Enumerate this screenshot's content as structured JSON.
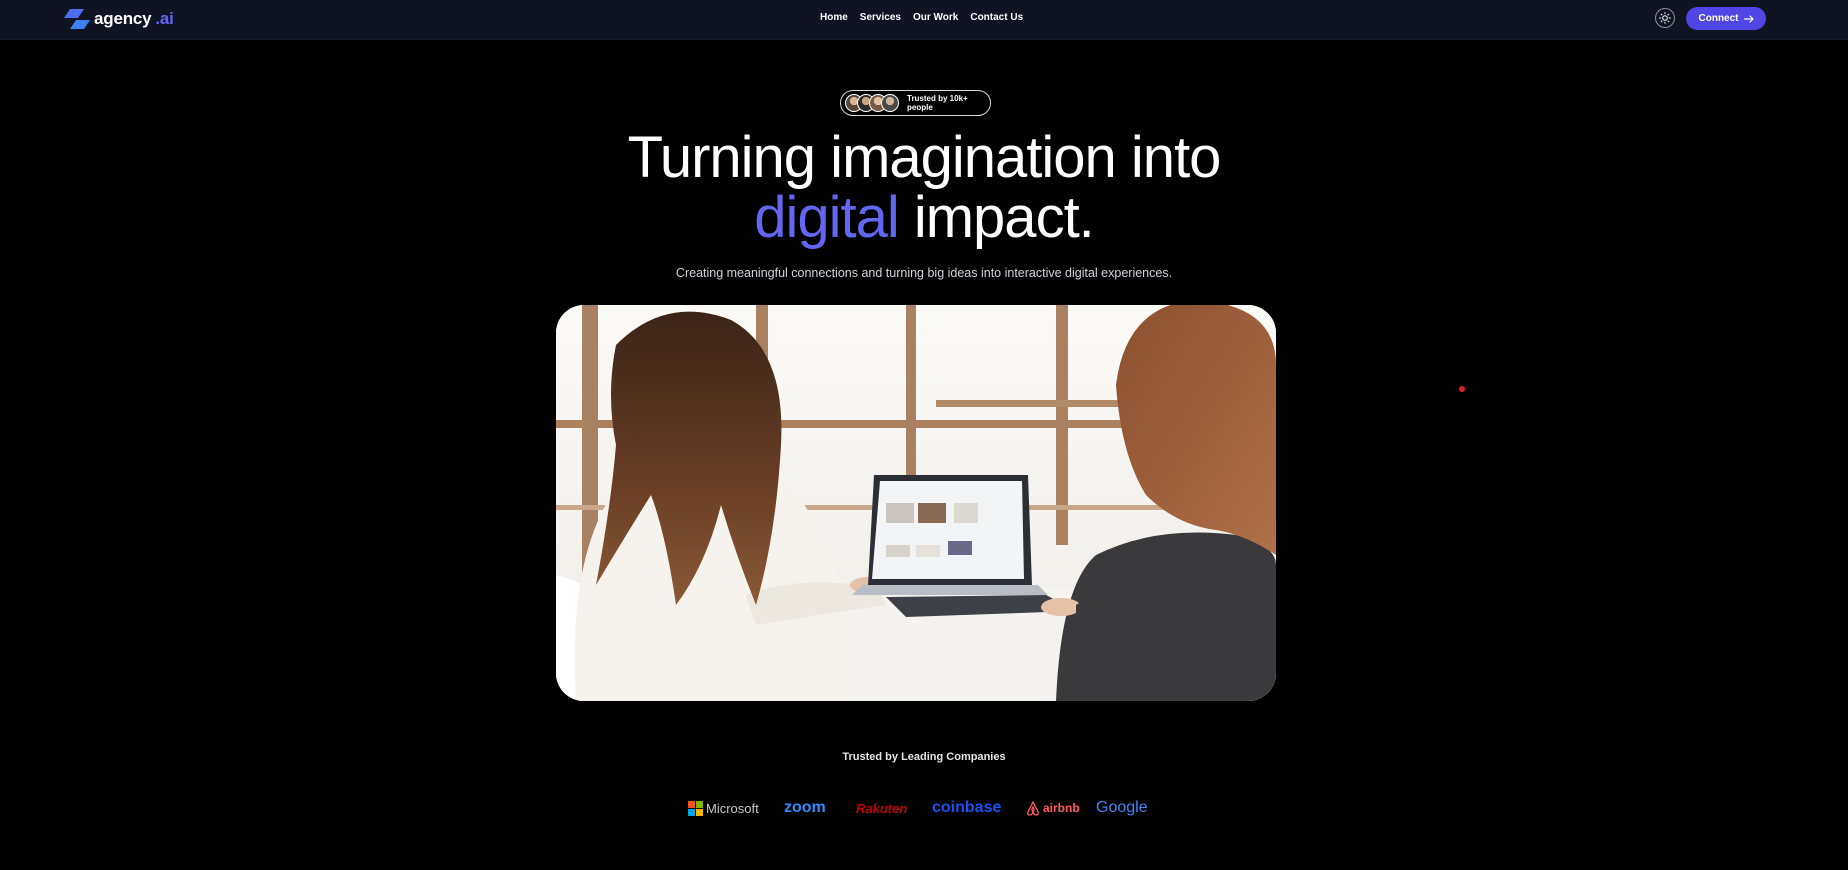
{
  "brand": {
    "name": "agency",
    "accent": ".ai"
  },
  "nav": {
    "links": [
      "Home",
      "Services",
      "Our Work",
      "Contact Us"
    ],
    "connect_label": "Connect"
  },
  "hero": {
    "trust_text": "Trusted by 10k+ people",
    "headline_line1": "Turning imagination into",
    "headline_accent": "digital",
    "headline_rest": " impact.",
    "subtitle": "Creating meaningful connections and turning big ideas into interactive digital experiences."
  },
  "trusted": {
    "title": "Trusted by Leading Companies",
    "logos": [
      "Microsoft",
      "zoom",
      "Rakuten",
      "coinbase",
      "airbnb",
      "Google"
    ]
  },
  "colors": {
    "accent": "#6366f1",
    "button": "#4f46e5",
    "nav_bg": "#0f1322",
    "zoom": "#2d8cff",
    "rakuten": "#bf0000",
    "coinbase": "#1652f0",
    "airbnb": "#ff5a5f"
  }
}
